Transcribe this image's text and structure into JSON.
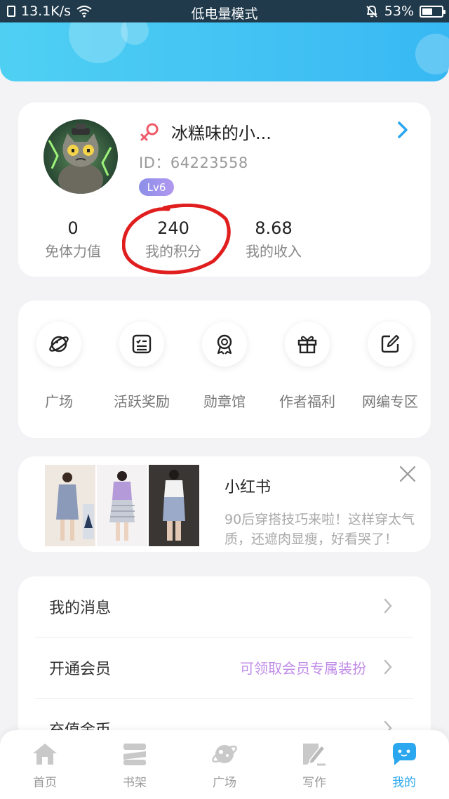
{
  "status_bar": {
    "network_speed": "13.1K/s",
    "mode": "低电量模式",
    "battery": "53%",
    "battery_level": 0.53
  },
  "profile": {
    "name": "冰糕味的小...",
    "id_text": "ID：64223558",
    "level": "Lv6",
    "stats": [
      {
        "value": "0",
        "label": "免体力值"
      },
      {
        "value": "240",
        "label": "我的积分"
      },
      {
        "value": "8.68",
        "label": "我的收入"
      }
    ]
  },
  "features": [
    {
      "label": "广场",
      "icon": "planet-icon"
    },
    {
      "label": "活跃奖励",
      "icon": "checklist-icon"
    },
    {
      "label": "勋章馆",
      "icon": "medal-icon"
    },
    {
      "label": "作者福利",
      "icon": "gift-icon"
    },
    {
      "label": "网编专区",
      "icon": "edit-icon"
    }
  ],
  "ad": {
    "title": "小红书",
    "text": "90后穿搭技巧来啦！这样穿太气质，还遮肉显瘦，好看哭了！"
  },
  "menu": [
    {
      "label": "我的消息",
      "sub": ""
    },
    {
      "label": "开通会员",
      "sub": "可领取会员专属装扮"
    },
    {
      "label": "充值金币",
      "sub": ""
    }
  ],
  "tabs": [
    {
      "label": "首页",
      "icon": "home-icon"
    },
    {
      "label": "书架",
      "icon": "bookshelf-icon"
    },
    {
      "label": "广场",
      "icon": "planet-icon"
    },
    {
      "label": "写作",
      "icon": "pen-icon"
    },
    {
      "label": "我的",
      "icon": "chat-bubble-icon",
      "active": true
    }
  ],
  "colors": {
    "accent": "#2aa7ee",
    "banner": "#3fc4f3",
    "vip_text": "#c08ce8",
    "annotation": "#e01e1e"
  }
}
